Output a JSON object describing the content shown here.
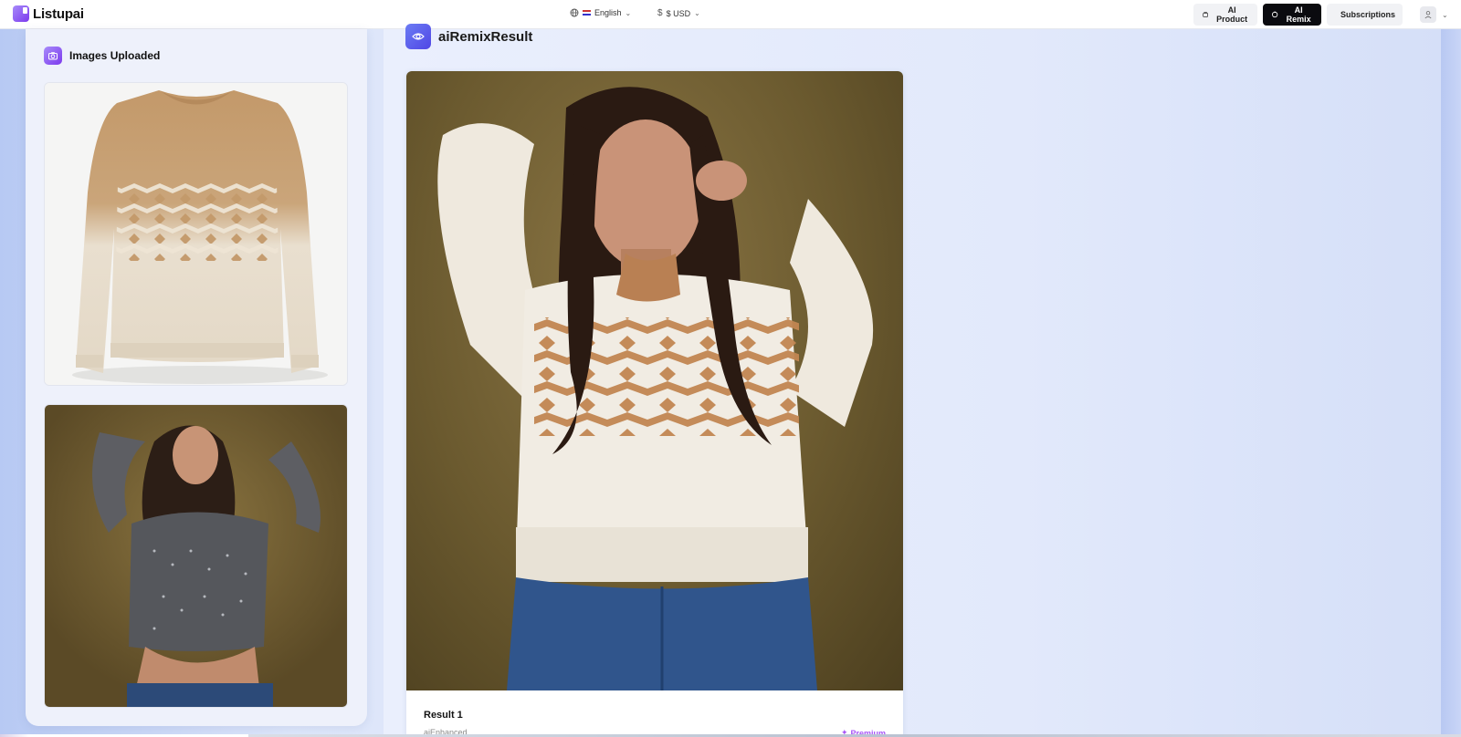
{
  "app": {
    "name": "Listupai"
  },
  "header": {
    "language": "English",
    "currency": "$ USD",
    "nav": [
      {
        "label": "AI Product",
        "icon": "cube-icon"
      },
      {
        "label": "AI Remix",
        "icon": "sparkle-icon",
        "active": true
      },
      {
        "label": "Subscriptions",
        "icon": "card-icon"
      }
    ]
  },
  "uploads": {
    "title": "Images Uploaded",
    "images": [
      {
        "alt": "sweater-product-photo"
      },
      {
        "alt": "model-reference-photo"
      }
    ]
  },
  "result": {
    "title": "aiRemixResult",
    "items": [
      {
        "label": "Result 1",
        "tag": "aiEnhanced",
        "badge": "Premium"
      }
    ]
  },
  "colors": {
    "accent": "#7c3aed",
    "active_nav": "#0b0b0f",
    "premium": "#a855f7",
    "sweater_tan": "#c49a6c",
    "sweater_cream": "#efe7da"
  }
}
